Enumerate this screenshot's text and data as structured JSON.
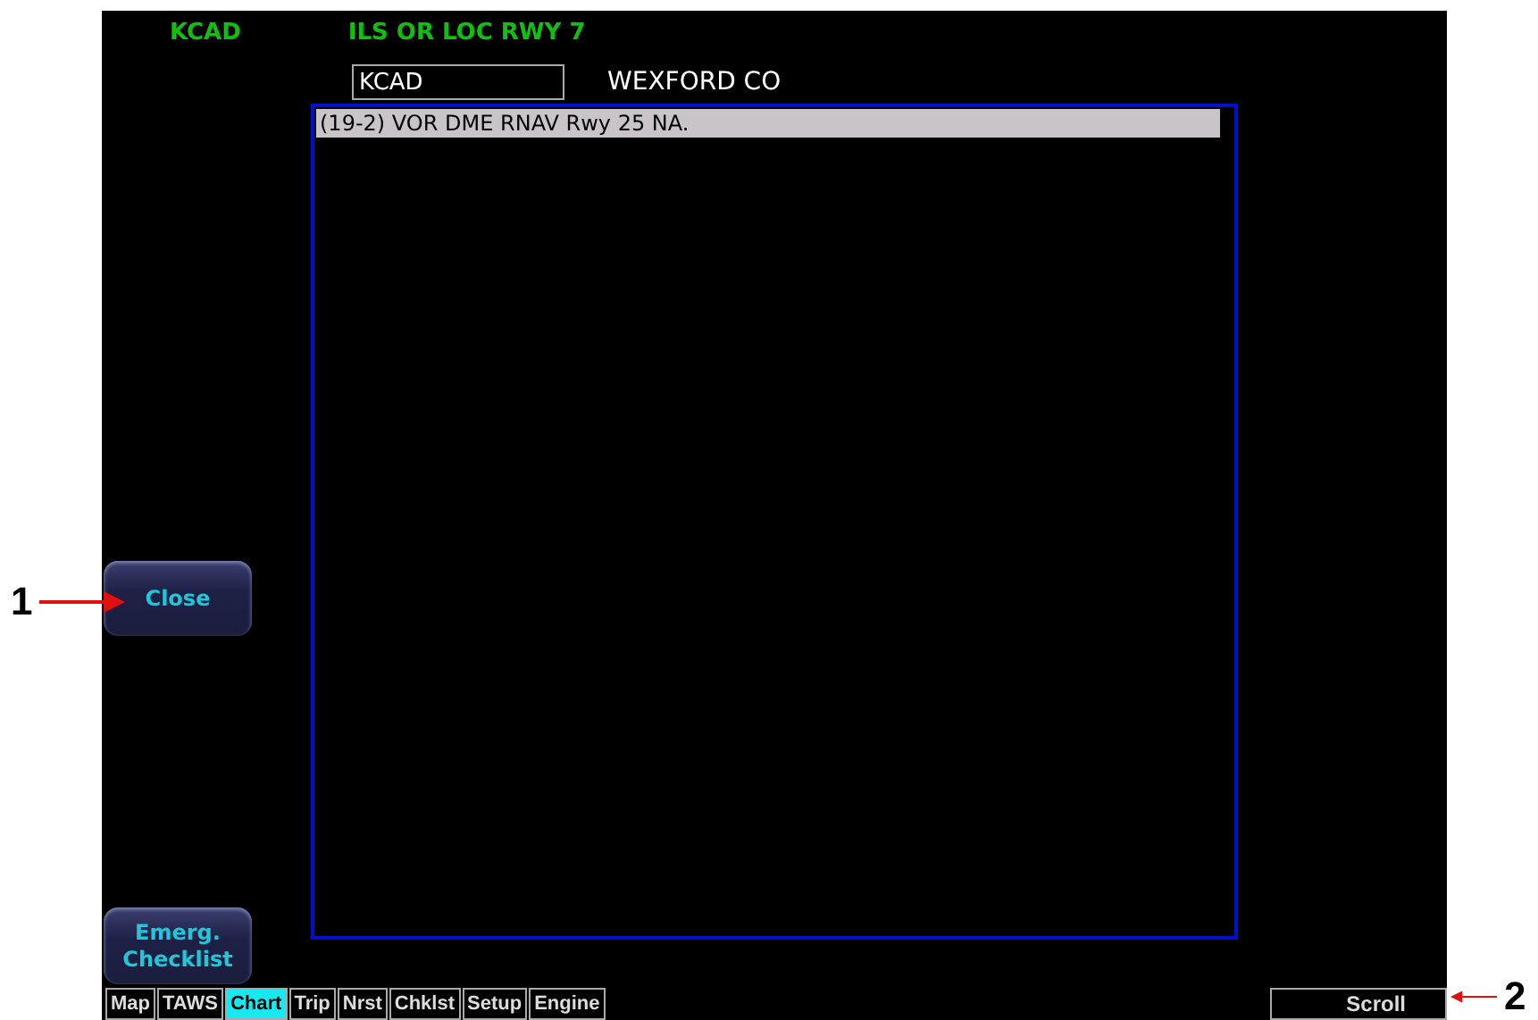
{
  "header": {
    "airport": "KCAD",
    "procedure": "ILS OR LOC RWY 7"
  },
  "airport_field": {
    "value": "KCAD"
  },
  "airport_name": "WEXFORD CO",
  "notes": [
    {
      "text": "(19-2) VOR DME RNAV Rwy 25 NA.",
      "selected": true
    }
  ],
  "buttons": [
    {
      "label": "Close"
    },
    {
      "label": "Emerg.\nChecklist"
    }
  ],
  "tabs": [
    {
      "label": "Map",
      "selected": false
    },
    {
      "label": "TAWS",
      "selected": false
    },
    {
      "label": "Chart",
      "selected": true
    },
    {
      "label": "Trip",
      "selected": false
    },
    {
      "label": "Nrst",
      "selected": false
    },
    {
      "label": "Chklst",
      "selected": false
    },
    {
      "label": "Setup",
      "selected": false
    },
    {
      "label": "Engine",
      "selected": false
    }
  ],
  "softkey": "Scroll",
  "callouts": [
    {
      "number": "1"
    },
    {
      "number": "2"
    }
  ]
}
